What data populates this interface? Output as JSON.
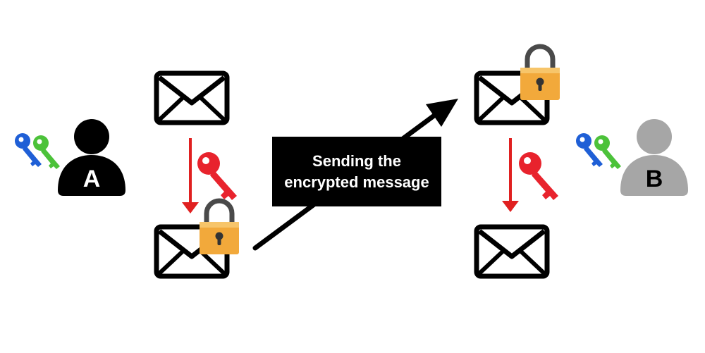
{
  "message_label": {
    "line1": "Sending the",
    "line2": "encrypted message"
  },
  "person_a": {
    "letter": "A",
    "color": "#000000"
  },
  "person_b": {
    "letter": "B",
    "color": "#a6a6a6"
  },
  "icons": {
    "envelope": "envelope-icon",
    "padlock": "padlock-icon",
    "private_key": "red-key-icon",
    "key_pair": "blue-green-keys-icon"
  },
  "colors": {
    "arrow_red": "#e02020",
    "key_red": "#e8232d",
    "key_blue": "#1f5fd6",
    "key_green": "#4cc23a",
    "padlock_gold": "#f2a93b",
    "label_bg": "#000000"
  }
}
